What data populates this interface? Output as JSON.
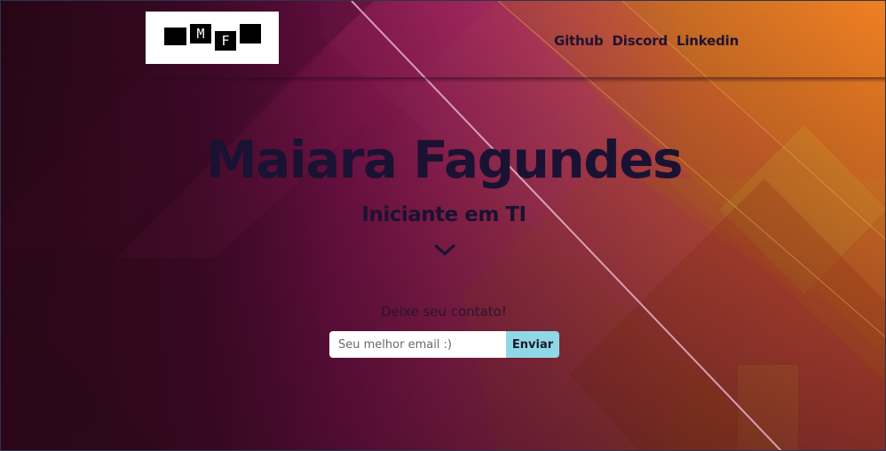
{
  "header": {
    "logo": {
      "letters": [
        "M",
        "F"
      ]
    },
    "nav": [
      {
        "label": "Github"
      },
      {
        "label": "Discord"
      },
      {
        "label": "Linkedin"
      }
    ]
  },
  "hero": {
    "title": "Maiara Fagundes",
    "subtitle": "Iniciante em TI",
    "scroll_icon": "chevron-down-icon"
  },
  "contact": {
    "label": "Deixe seu contato!",
    "email_placeholder": "Seu melhor email :)",
    "email_value": "",
    "submit_label": "Enviar"
  },
  "colors": {
    "text_dark": "#1a1233",
    "button_bg": "#8fd8e6",
    "bg_magenta": "#e0248a",
    "bg_orange": "#f07a1a",
    "bg_dark": "#3a0f24"
  }
}
